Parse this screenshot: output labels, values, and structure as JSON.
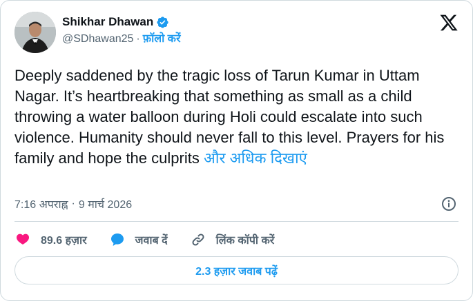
{
  "author": {
    "name": "Shikhar Dhawan",
    "handle": "@SDhawan25",
    "separator": "·",
    "follow_label": "फ़ॉलो करें"
  },
  "icons": {
    "verified": "verified-badge-icon",
    "platform": "x-logo-icon",
    "info": "info-icon",
    "like": "heart-icon",
    "reply": "speech-bubble-icon",
    "copy_link": "link-icon"
  },
  "tweet": {
    "text": "Deeply saddened by the tragic loss of Tarun Kumar in Uttam Nagar. It’s heartbreaking that something as small as a child throwing a water balloon during Holi could escalate into such violence. Humanity should never fall to this level. Prayers for his family and hope the culprits ",
    "show_more": "और अधिक दिखाएं"
  },
  "meta": {
    "time": "7:16 अपराह्न",
    "separator": "·",
    "date": "9 मार्च 2026"
  },
  "actions": {
    "likes": "89.6 हज़ार",
    "reply": "जवाब दें",
    "copy_link": "लिंक कॉपी करें"
  },
  "replies_button": "2.3 हज़ार जवाब पढ़ें",
  "colors": {
    "accent": "#1d9bf0",
    "like": "#f91880",
    "text": "#0f1419",
    "muted": "#536471",
    "border": "#cfd9de"
  }
}
